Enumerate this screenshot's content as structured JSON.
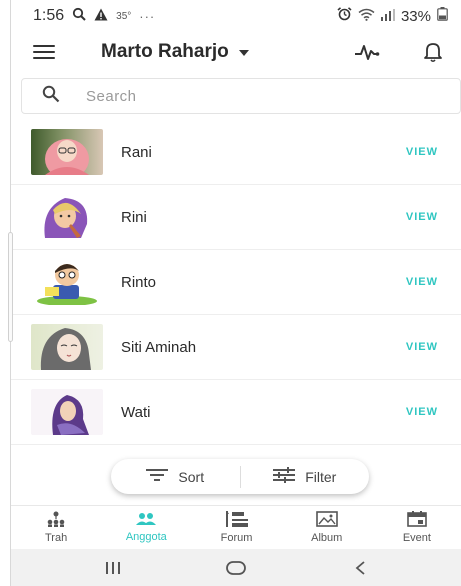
{
  "statusbar": {
    "time": "1:56",
    "temperature": "35°",
    "more": "···",
    "battery": "33%"
  },
  "appbar": {
    "account_name": "Marto Raharjo"
  },
  "search": {
    "placeholder": "Search"
  },
  "members": [
    {
      "name": "Rani",
      "action": "VIEW"
    },
    {
      "name": "Rini",
      "action": "VIEW"
    },
    {
      "name": "Rinto",
      "action": "VIEW"
    },
    {
      "name": "Siti Aminah",
      "action": "VIEW"
    },
    {
      "name": "Wati",
      "action": "VIEW"
    }
  ],
  "toolbar": {
    "sort_label": "Sort",
    "filter_label": "Filter"
  },
  "bottom_nav": [
    {
      "label": "Trah",
      "icon": "family-tree-icon"
    },
    {
      "label": "Anggota",
      "icon": "members-icon",
      "active": true
    },
    {
      "label": "Forum",
      "icon": "forum-icon"
    },
    {
      "label": "Album",
      "icon": "album-icon"
    },
    {
      "label": "Event",
      "icon": "event-icon"
    }
  ],
  "colors": {
    "accent": "#2fc6c1",
    "text": "#2a2a2a"
  }
}
